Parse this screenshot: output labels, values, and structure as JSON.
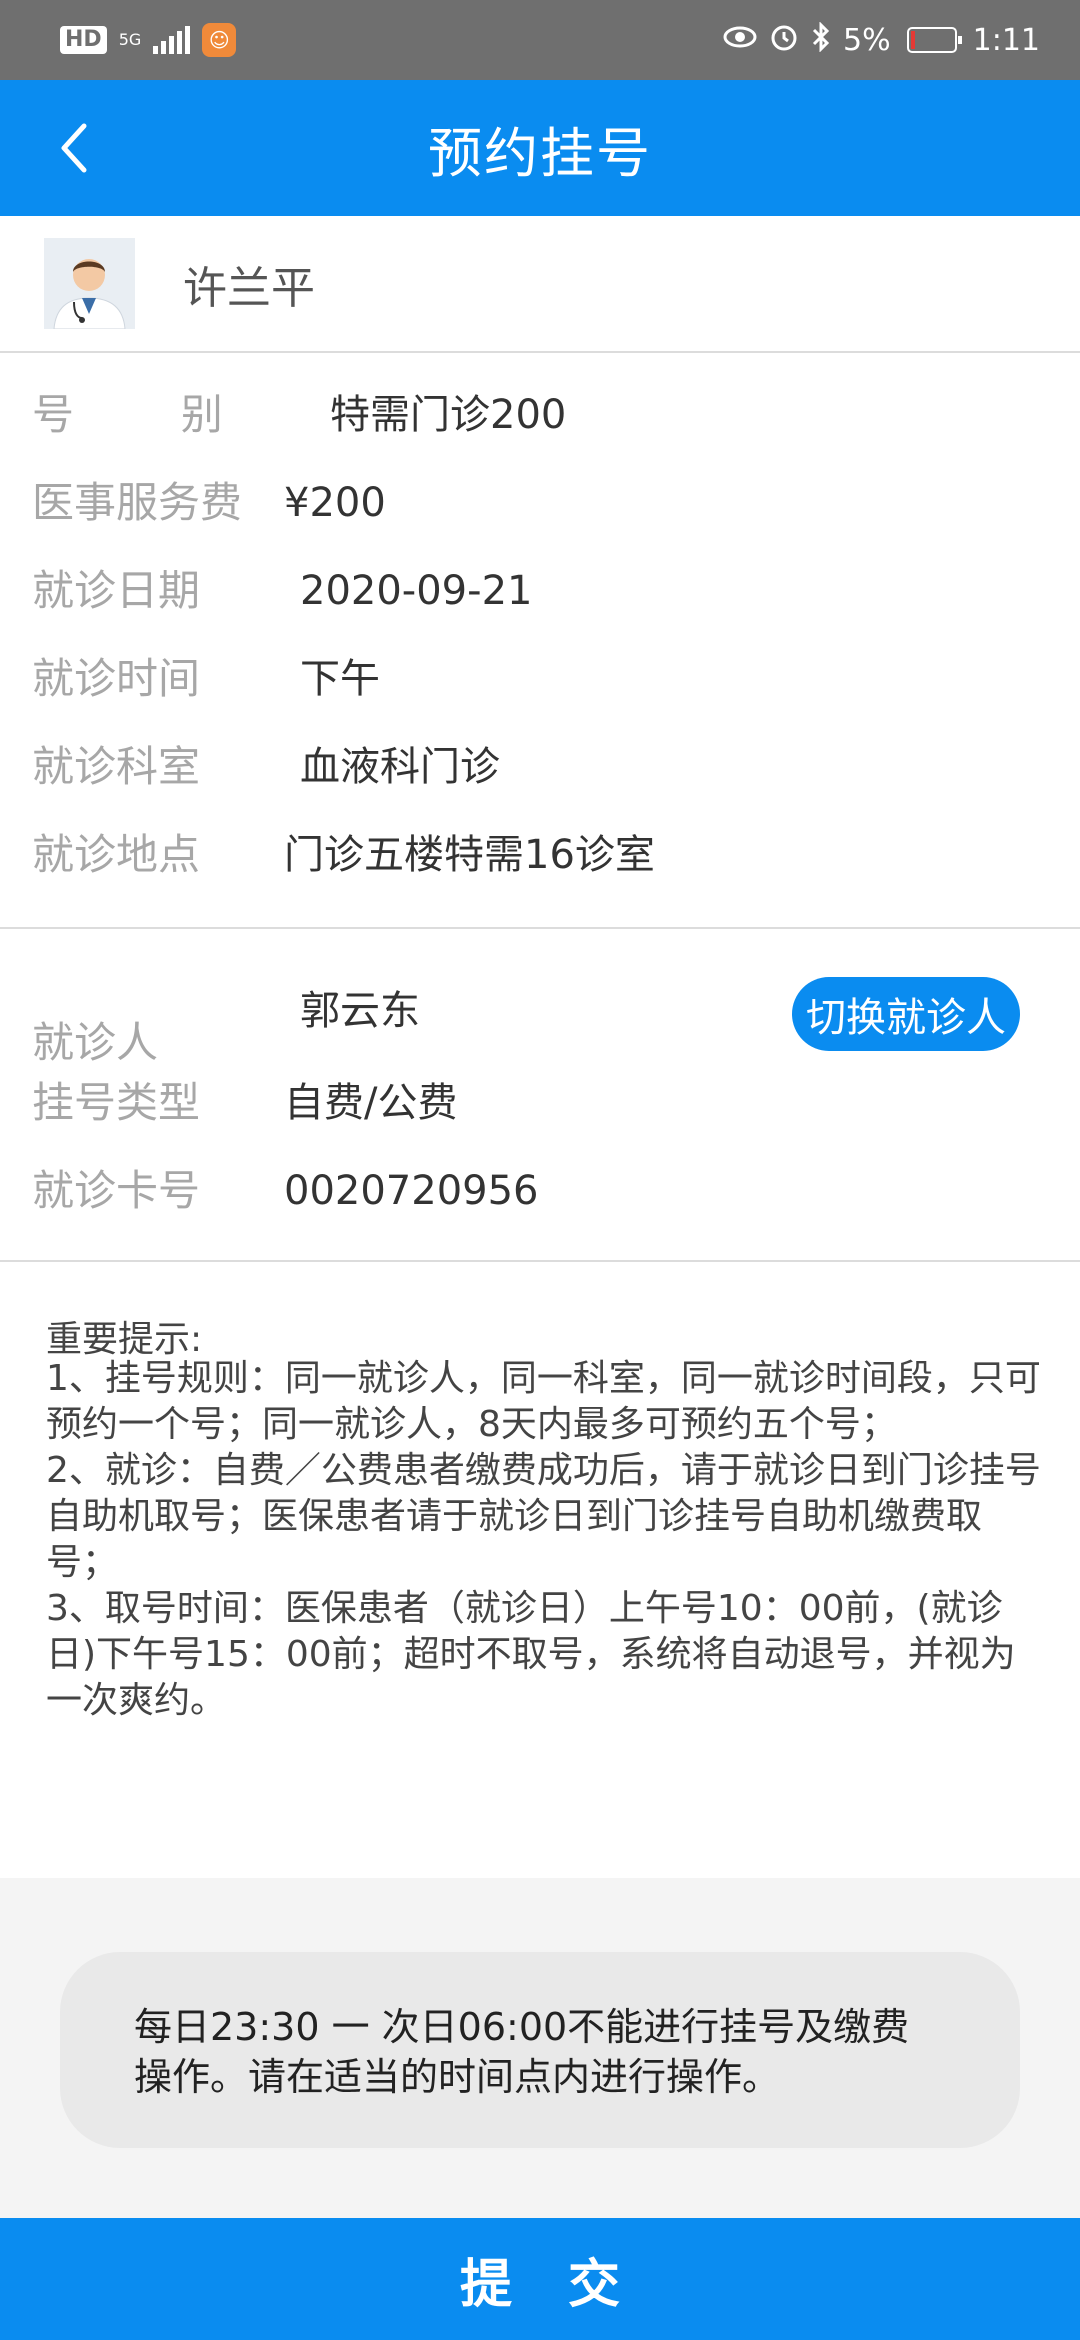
{
  "status_bar": {
    "hd": "HD",
    "network": "5G",
    "battery": "5%",
    "time": "1:11",
    "battery_color": "#e53935"
  },
  "header": {
    "title": "预约挂号",
    "back_icon": "chevron-left-icon",
    "bg_color": "#0a8cf0"
  },
  "doctor": {
    "name": "许兰平",
    "avatar_icon": "doctor-avatar-icon"
  },
  "appointment": {
    "rows": [
      {
        "label": "号        别",
        "value": "特需门诊200"
      },
      {
        "label": "医事服务费",
        "value": "¥200"
      },
      {
        "label": "就诊日期",
        "value": "2020-09-21"
      },
      {
        "label": "就诊时间",
        "value": "下午"
      },
      {
        "label": "就诊科室",
        "value": "血液科门诊"
      },
      {
        "label": "就诊地点",
        "value": "门诊五楼特需16诊室"
      }
    ]
  },
  "patient": {
    "rows": [
      {
        "label": "就诊人",
        "value": "郭云东"
      },
      {
        "label": "挂号类型",
        "value": "自费/公费"
      },
      {
        "label": "就诊卡号",
        "value": "0020720956"
      }
    ],
    "switch_label": "切换就诊人"
  },
  "notice": {
    "title": "重要提示:",
    "items": [
      "1、挂号规则：同一就诊人，同一科室，同一就诊时间段，只可预约一个号；同一就诊人，8天内最多可预约五个号；",
      "2、就诊：自费／公费患者缴费成功后，请于就诊日到门诊挂号自助机取号；医保患者请于就诊日到门诊挂号自助机缴费取号；",
      "3、取号时间：医保患者（就诊日）上午号10：00前，(就诊日)下午号15：00前；超时不取号，系统将自动退号，并视为一次爽约。"
    ]
  },
  "time_notice": "每日23:30 一 次日06:00不能进行挂号及缴费操作。请在适当的时间点内进行操作。",
  "submit_label": "提交"
}
